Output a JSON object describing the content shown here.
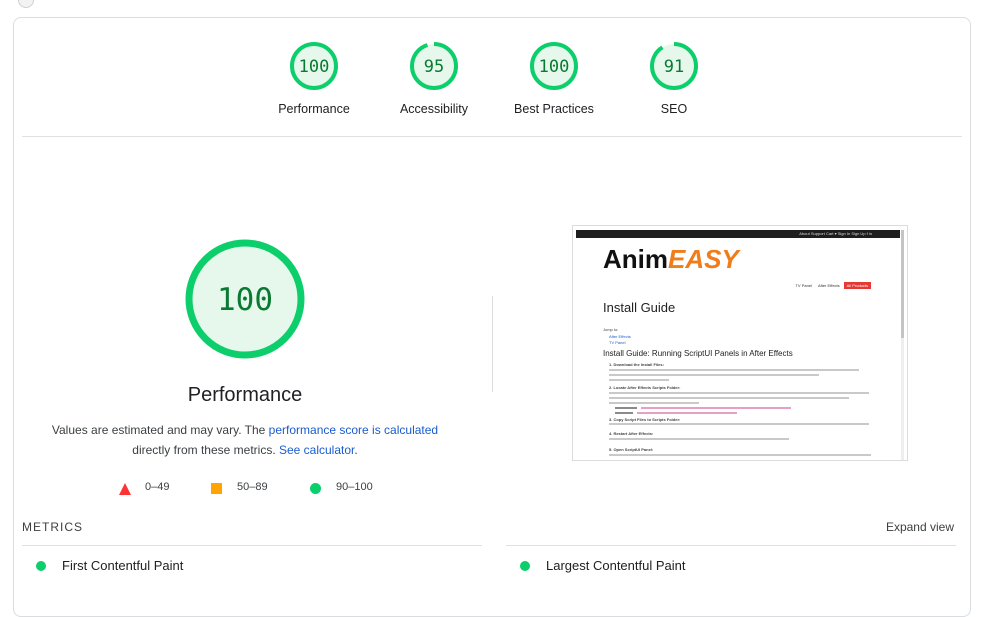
{
  "colors": {
    "pass": "#0cce6b",
    "pass_fill": "#e6f8ec",
    "pass_text": "#0a7a32",
    "average": "#ffa400",
    "fail": "#ff3333",
    "link": "#1a5cce"
  },
  "gauges": [
    {
      "score": "100",
      "value": 100,
      "label": "Performance"
    },
    {
      "score": "95",
      "value": 95,
      "label": "Accessibility"
    },
    {
      "score": "100",
      "value": 100,
      "label": "Best Practices"
    },
    {
      "score": "91",
      "value": 91,
      "label": "SEO"
    }
  ],
  "performance": {
    "score": "100",
    "value": 100,
    "title": "Performance",
    "desc_prefix": "Values are estimated and may vary. The ",
    "desc_link1": "performance score is calculated",
    "desc_middle": " directly from these metrics. ",
    "desc_link2": "See calculator",
    "desc_suffix": "."
  },
  "legend": [
    {
      "icon": "triangle-icon",
      "range": "0–49"
    },
    {
      "icon": "square-icon",
      "range": "50–89"
    },
    {
      "icon": "circle-icon",
      "range": "90–100"
    }
  ],
  "screenshot": {
    "top_links": "About   Support   Cart ▾   Sign In   Sign Up   f   in",
    "logo_main": "Anim",
    "logo_accent": "EASY",
    "nav_item1": "TV Panel",
    "nav_item2": "After Effects",
    "nav_button": "All Products",
    "heading": "Install Guide",
    "jump_to": "Jump to:",
    "jump_link1": "After Effects",
    "jump_link2": "TV Panel",
    "subheading": "Install Guide: Running ScriptUI Panels in After Effects",
    "step1": "1. Download the Install Files:",
    "step2": "2. Locate After Effects Scripts Folder:",
    "step3": "3. Copy Script Files to Scripts Folder:",
    "step4": "4. Restart After Effects:",
    "step5": "5. Open ScriptUI Panel:"
  },
  "metrics": {
    "label": "METRICS",
    "expand": "Expand view",
    "items": [
      {
        "name": "First Contentful Paint"
      },
      {
        "name": "Largest Contentful Paint"
      }
    ]
  }
}
